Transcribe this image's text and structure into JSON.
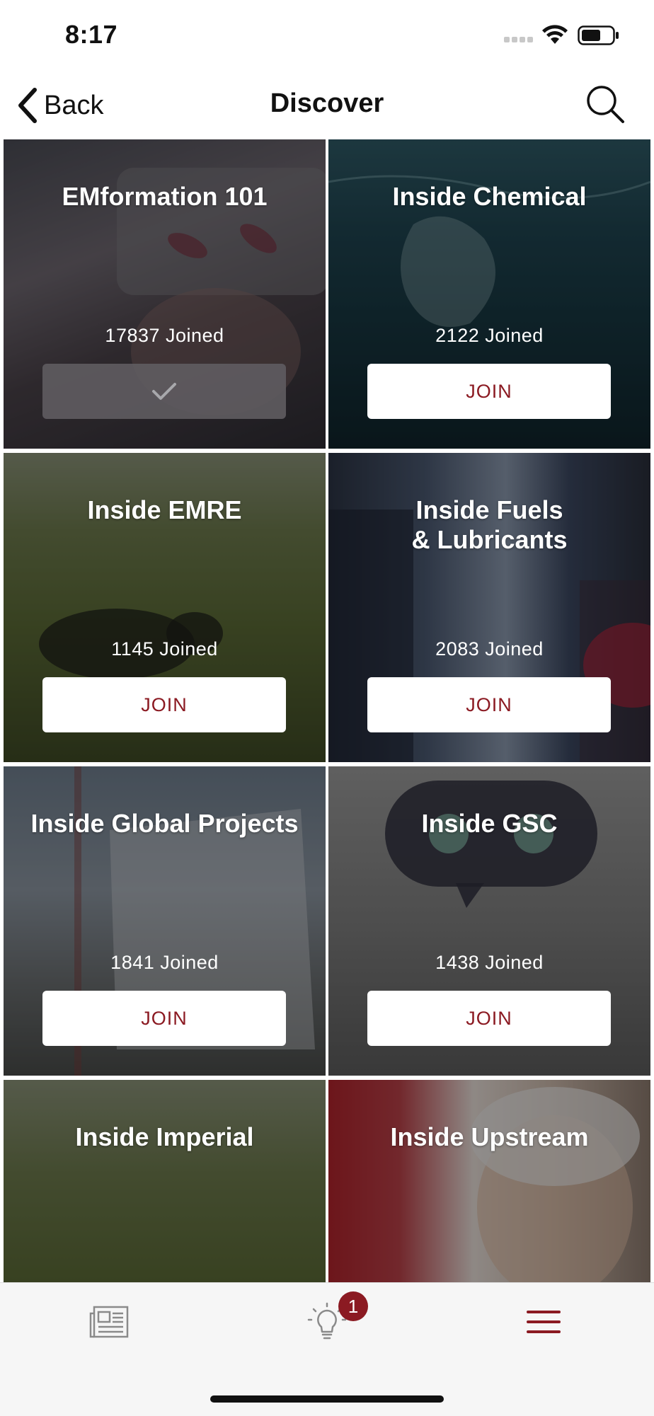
{
  "status_bar": {
    "time": "8:17"
  },
  "nav": {
    "back_label": "Back",
    "title": "Discover"
  },
  "cards": [
    {
      "title": "EMformation 101",
      "joined": "17837 Joined",
      "joined_state": true,
      "button_label": ""
    },
    {
      "title": "Inside Chemical",
      "joined": "2122 Joined",
      "joined_state": false,
      "button_label": "JOIN"
    },
    {
      "title": "Inside EMRE",
      "joined": "1145 Joined",
      "joined_state": false,
      "button_label": "JOIN"
    },
    {
      "title": "Inside Fuels\n& Lubricants",
      "joined": "2083 Joined",
      "joined_state": false,
      "button_label": "JOIN"
    },
    {
      "title": "Inside Global Projects",
      "joined": "1841 Joined",
      "joined_state": false,
      "button_label": "JOIN"
    },
    {
      "title": "Inside GSC",
      "joined": "1438 Joined",
      "joined_state": false,
      "button_label": "JOIN"
    },
    {
      "title": "Inside Imperial",
      "joined": "",
      "joined_state": false,
      "button_label": ""
    },
    {
      "title": "Inside Upstream",
      "joined": "",
      "joined_state": false,
      "button_label": ""
    }
  ],
  "tab_bar": {
    "items": [
      {
        "icon": "newspaper-icon",
        "active": false
      },
      {
        "icon": "lightbulb-icon",
        "active": false,
        "badge": "1"
      },
      {
        "icon": "menu-icon",
        "active": true
      }
    ]
  },
  "colors": {
    "accent": "#8b1a22",
    "tab_inactive": "#8a8a8a"
  }
}
